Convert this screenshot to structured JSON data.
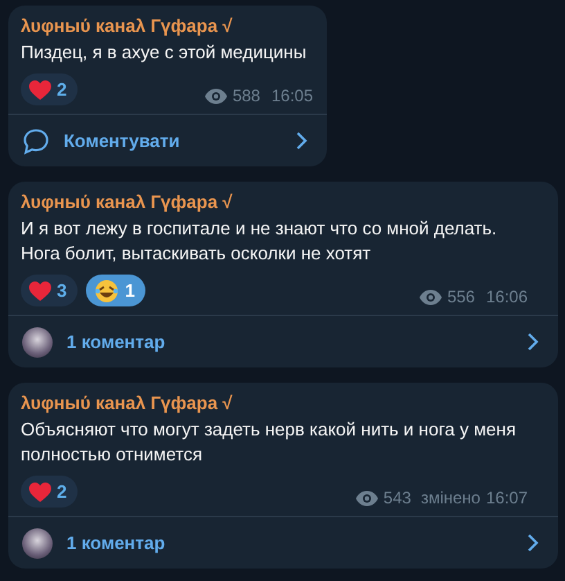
{
  "messages": [
    {
      "author": "λυφныύ канаλ Гүфара √",
      "text": "Пиздец, я в ахуе с этой медицины",
      "wide": false,
      "reactions": [
        {
          "kind": "heart",
          "count": "2",
          "selected": false
        }
      ],
      "views": "588",
      "time": "16:05",
      "footer": {
        "kind": "comment",
        "label": "Коментувати"
      }
    },
    {
      "author": "λυφныύ канаλ Гүфара √",
      "text": "И я вот лежу в госпитале и не знают что со мной делать. Нога болит, вытаскивать осколки не хотят",
      "wide": true,
      "reactions": [
        {
          "kind": "heart",
          "count": "3",
          "selected": false
        },
        {
          "kind": "laugh",
          "count": "1",
          "selected": true
        }
      ],
      "views": "556",
      "time": "16:06",
      "footer": {
        "kind": "avatar",
        "label": "1 коментар"
      }
    },
    {
      "author": "λυφныύ канаλ Гүфара √",
      "text": "Объясняют что могут задеть нерв какой нить и нога у меня полностью отнимется",
      "wide": true,
      "reactions": [
        {
          "kind": "heart",
          "count": "2",
          "selected": false
        }
      ],
      "views": "543",
      "edited": "змінено",
      "time": "16:07",
      "footer": {
        "kind": "avatar",
        "label": "1 коментар"
      }
    }
  ]
}
